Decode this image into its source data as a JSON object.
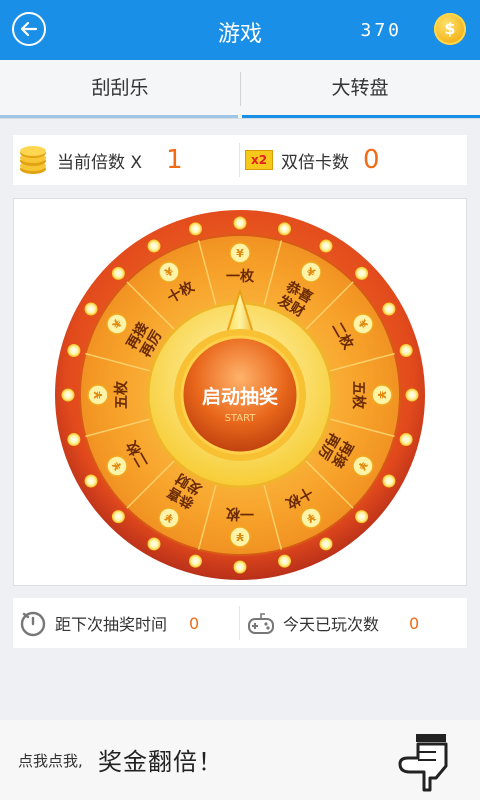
{
  "header": {
    "title": "游戏",
    "coins": "370",
    "coin_symbol": "$"
  },
  "tabs": [
    {
      "label": "刮刮乐",
      "active": false
    },
    {
      "label": "大转盘",
      "active": true
    }
  ],
  "stats": {
    "multiplier_label": "当前倍数 X",
    "multiplier_value": "1",
    "double_card_badge": "x2",
    "double_card_label": "双倍卡数",
    "double_card_value": "0"
  },
  "wheel": {
    "center_text": "启动抽奖",
    "center_sub": "START",
    "coin_symbol": "¥",
    "segments": [
      "一枚",
      "恭喜发财",
      "二枚",
      "五枚",
      "再接再厉",
      "十枚",
      "一枚",
      "恭喜发财",
      "二枚",
      "五枚",
      "再接再厉",
      "十枚"
    ]
  },
  "timer": {
    "countdown_label": "距下次抽奖时间",
    "countdown_value": "0",
    "plays_label": "今天已玩次数",
    "plays_value": "0"
  },
  "promo": {
    "small_text": "点我点我,",
    "big_text": "奖金翻倍！"
  },
  "colors": {
    "header_blue": "#1a8fe8",
    "accent_orange": "#f26a16",
    "wheel_orange": "#f39a1e",
    "wheel_rim": "#d9421b"
  }
}
